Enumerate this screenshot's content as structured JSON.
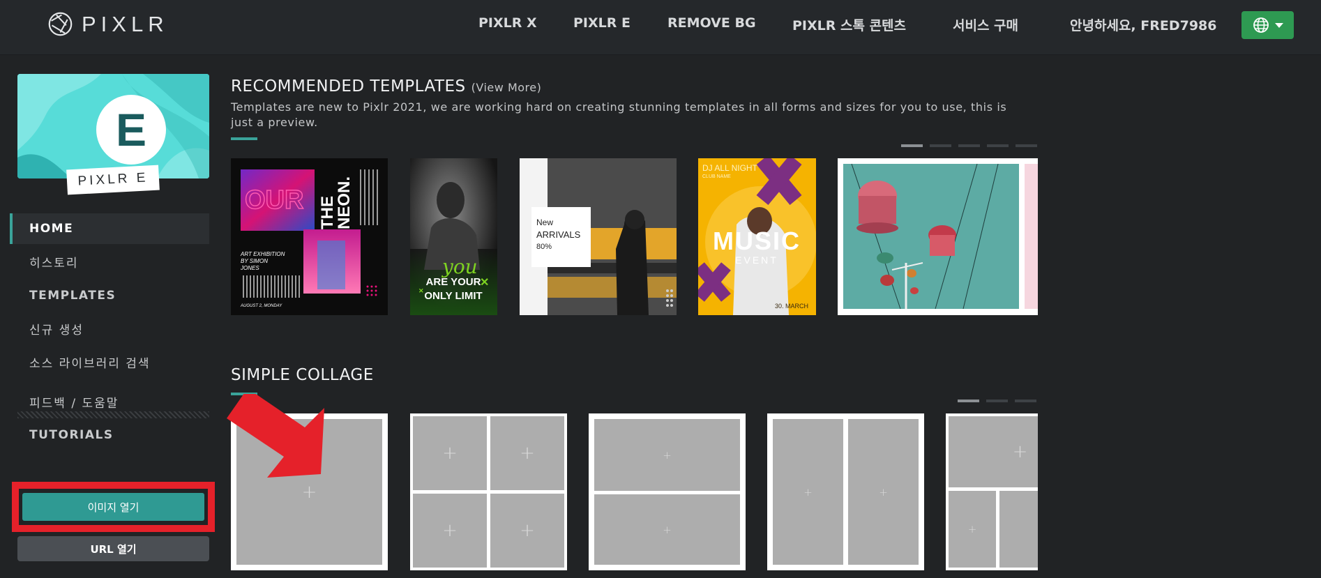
{
  "header": {
    "logo_text": "PIXLR",
    "nav": [
      "PIXLR X",
      "PIXLR E",
      "REMOVE BG",
      "PIXLR 스톡 콘텐츠",
      "서비스 구매",
      "안녕하세요, FRED7986"
    ],
    "lang_icon": "globe-icon",
    "lang_color": "#2e9a52"
  },
  "sidebar": {
    "app_letter": "E",
    "app_tag": "PIXLR E",
    "items": [
      {
        "label": "HOME",
        "active": true
      },
      {
        "label": "히스토리"
      },
      {
        "label": "TEMPLATES"
      },
      {
        "label": "신규 생성"
      },
      {
        "label": "소스 라이브러리 검색"
      },
      {
        "label": "피드백 / 도움말"
      },
      {
        "label": "TUTORIALS"
      }
    ],
    "open_image": "이미지 열기",
    "open_url": "URL 열기"
  },
  "templates": {
    "title": "RECOMMENDED TEMPLATES",
    "view_more": "(View More)",
    "description": "Templates are new to Pixlr 2021, we are working hard on creating stunning templates in all forms and sizes for you to use, this is just a preview.",
    "pager_count": 5,
    "items": [
      {
        "name": "neon",
        "lines": [
          "OUR",
          "THE",
          "NEON.",
          "ART EXHIBITION",
          "BY SIMON",
          "JONES",
          "AUGUST 2, MONDAY"
        ]
      },
      {
        "name": "fitness",
        "lines": [
          "you",
          "ARE YOUR",
          "ONLY LIMIT"
        ]
      },
      {
        "name": "arrivals",
        "lines": [
          "New",
          "ARRIVALS",
          "80%"
        ]
      },
      {
        "name": "music",
        "lines": [
          "DJ ALL NIGHT",
          "CLUB NAME",
          "MUSIC",
          "EVENT",
          "30. MARCH"
        ]
      },
      {
        "name": "gondola",
        "lines": []
      }
    ]
  },
  "collage": {
    "title": "SIMPLE COLLAGE",
    "pager_count": 3,
    "plus": "+"
  },
  "colors": {
    "accent": "#3aa39a",
    "highlight_red": "#e5212a",
    "bg": "#212325"
  }
}
